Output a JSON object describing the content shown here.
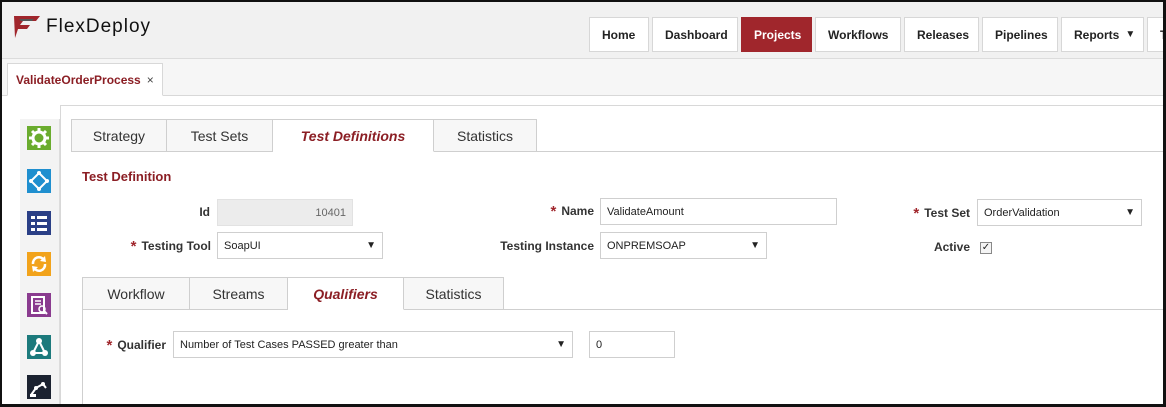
{
  "header": {
    "logo_text": "FlexDeploy",
    "nav": [
      {
        "label": "Home",
        "active": false
      },
      {
        "label": "Dashboard",
        "active": false
      },
      {
        "label": "Projects",
        "active": true
      },
      {
        "label": "Workflows",
        "active": false
      },
      {
        "label": "Releases",
        "active": false
      },
      {
        "label": "Pipelines",
        "active": false
      },
      {
        "label": "Reports",
        "active": false,
        "has_dropdown": true
      },
      {
        "label": "To",
        "active": false
      }
    ]
  },
  "doc_tab": {
    "label": "ValidateOrderProcess",
    "close": "×"
  },
  "side_icons": [
    "gear-icon",
    "workflow-icon",
    "list-icon",
    "refresh-icon",
    "report-icon",
    "graph-icon",
    "robot-icon"
  ],
  "tabs": [
    {
      "label": "Strategy",
      "active": false
    },
    {
      "label": "Test Sets",
      "active": false
    },
    {
      "label": "Test Definitions",
      "active": true
    },
    {
      "label": "Statistics",
      "active": false
    }
  ],
  "test_definition": {
    "title": "Test Definition",
    "id_label": "Id",
    "id_value": "10401",
    "name_label": "Name",
    "name_value": "ValidateAmount",
    "test_set_label": "Test Set",
    "test_set_value": "OrderValidation",
    "testing_tool_label": "Testing Tool",
    "testing_tool_value": "SoapUI",
    "testing_instance_label": "Testing Instance",
    "testing_instance_value": "ONPREMSOAP",
    "active_label": "Active",
    "active_checked": true
  },
  "inner_tabs": [
    {
      "label": "Workflow",
      "active": false
    },
    {
      "label": "Streams",
      "active": false
    },
    {
      "label": "Qualifiers",
      "active": true
    },
    {
      "label": "Statistics",
      "active": false
    }
  ],
  "qualifier": {
    "label": "Qualifier",
    "value": "Number of Test Cases PASSED greater than",
    "amount": "0"
  },
  "colors": {
    "accent": "#a0262c",
    "title": "#8b1e24"
  }
}
